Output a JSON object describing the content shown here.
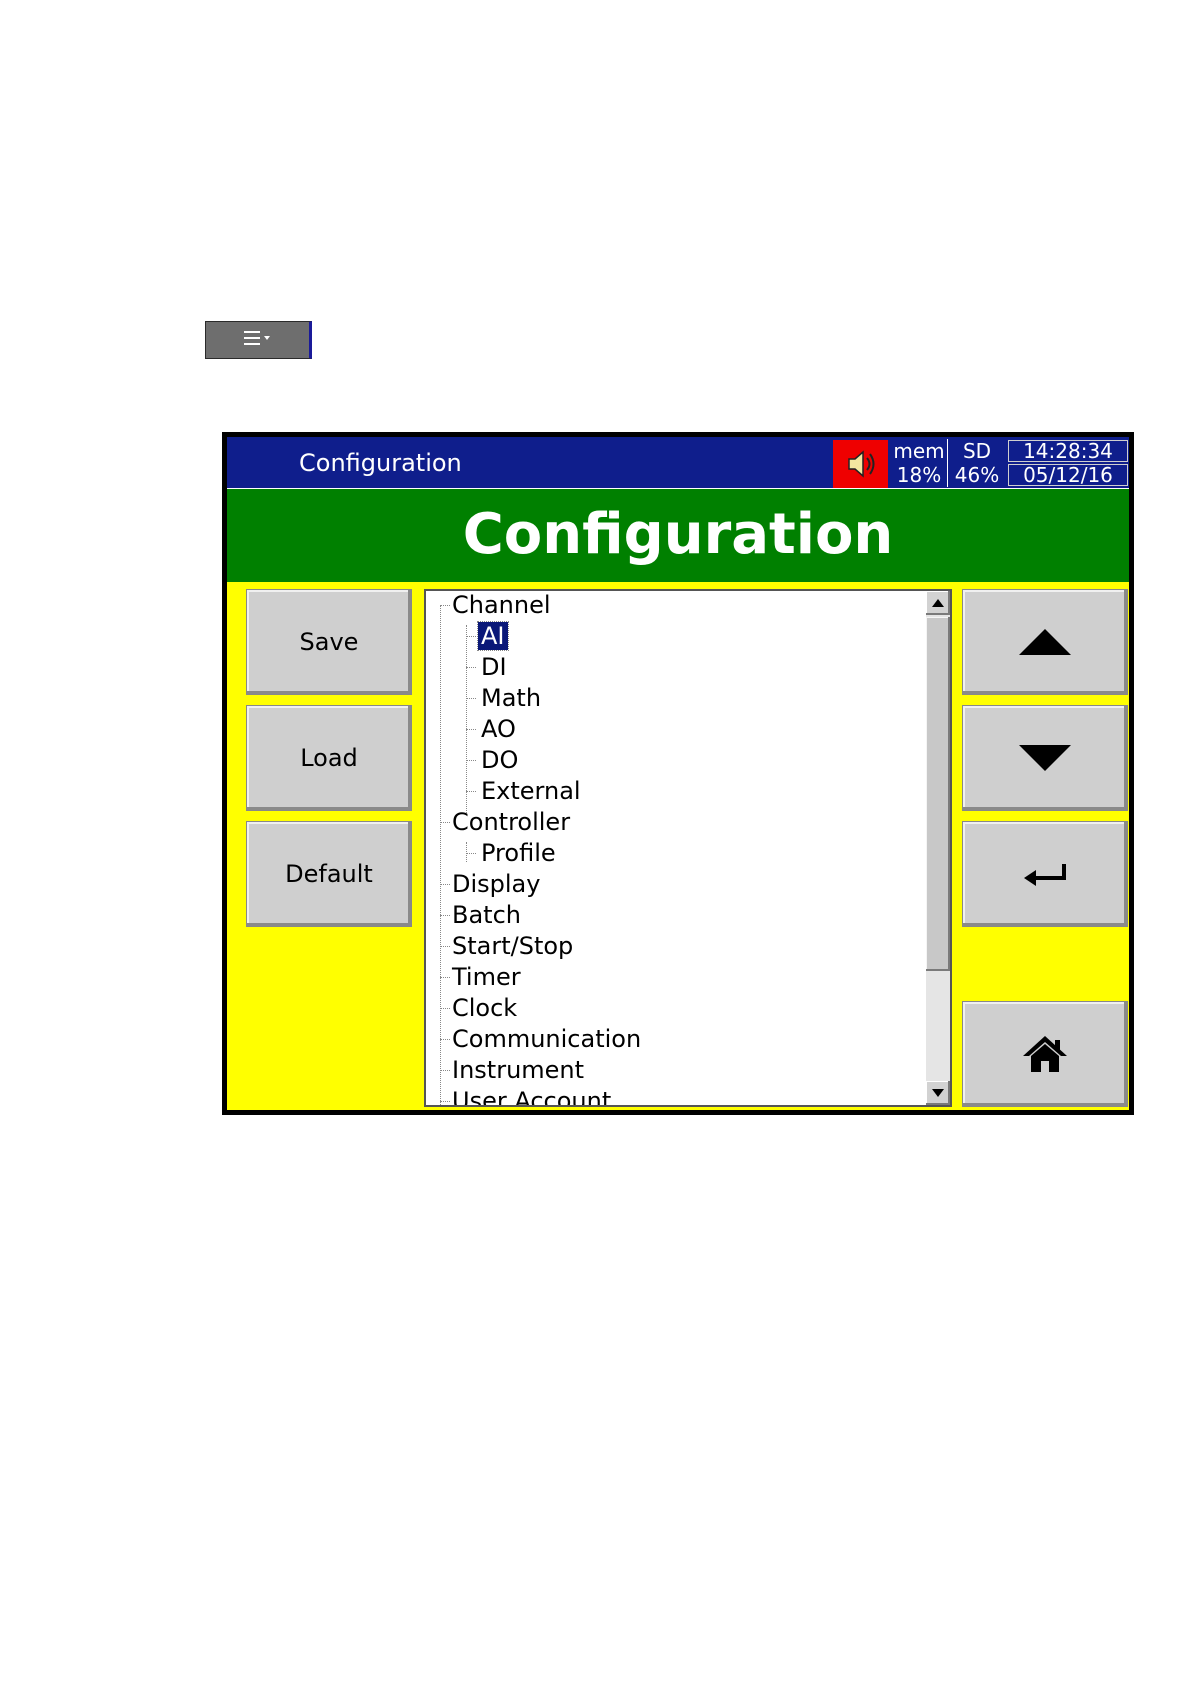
{
  "menu_button": {
    "icon": "menu-dropdown-icon"
  },
  "titlebar": {
    "title": "Configuration",
    "speaker_icon": "speaker-icon",
    "mem_label": "mem",
    "mem_value": "18%",
    "sd_label": "SD",
    "sd_value": "46%",
    "time": "14:28:34",
    "date": "05/12/16"
  },
  "banner": {
    "title": "Configuration"
  },
  "left_buttons": {
    "save": "Save",
    "load": "Load",
    "default": "Default"
  },
  "tree": {
    "items": [
      "Channel",
      "AI",
      "DI",
      "Math",
      "AO",
      "DO",
      "External",
      "Controller",
      "Profile",
      "Display",
      "Batch",
      "Start/Stop",
      "Timer",
      "Clock",
      "Communication",
      "Instrument",
      "User Account"
    ],
    "selected": "AI"
  },
  "right_buttons": {
    "up": "up-arrow-icon",
    "down": "down-arrow-icon",
    "enter": "enter-icon",
    "home": "home-icon"
  },
  "colors": {
    "titlebar": "#0f1e8c",
    "banner": "#008000",
    "background": "#ffff00",
    "speaker": "#ef0000"
  }
}
